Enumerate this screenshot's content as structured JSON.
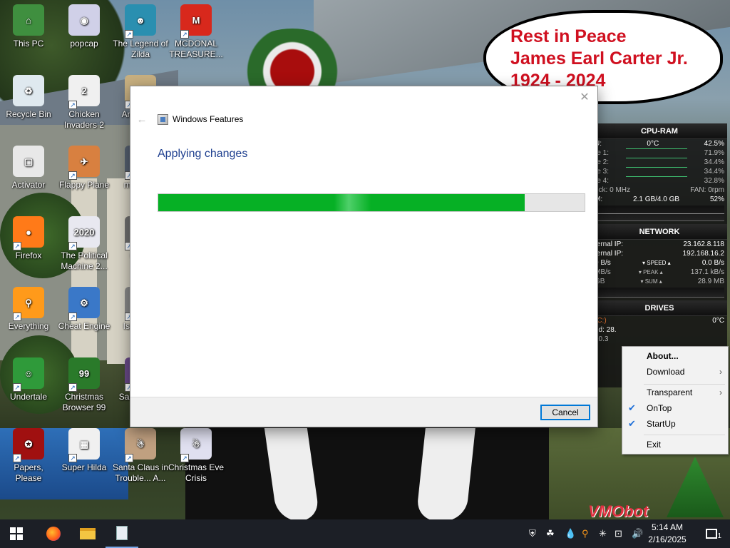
{
  "desktop_icons": [
    {
      "label": "This PC",
      "glyph": "⌂",
      "color": "#3f8f3f",
      "shortcut": false
    },
    {
      "label": "popcap",
      "glyph": "◉",
      "color": "#d0d0e8",
      "shortcut": false
    },
    {
      "label": "The Legend of Zilda",
      "glyph": "☻",
      "color": "#2a8fb0",
      "shortcut": true
    },
    {
      "label": "MCDONAL TREASURE...",
      "glyph": "M",
      "color": "#d8281c",
      "shortcut": true
    },
    {
      "label": "Recycle Bin",
      "glyph": "♻",
      "color": "#dfe9ef",
      "shortcut": false
    },
    {
      "label": "Chicken Invaders 2",
      "glyph": "2",
      "color": "#f0f0f0",
      "shortcut": true
    },
    {
      "label": "An... Se...",
      "glyph": "☺",
      "color": "#c8b080",
      "shortcut": true
    },
    {
      "label": "Activator",
      "glyph": "▢",
      "color": "#e8e8e8",
      "shortcut": false
    },
    {
      "label": "Flappy Plane",
      "glyph": "✈",
      "color": "#d88040",
      "shortcut": true
    },
    {
      "label": "mo... 9...",
      "glyph": "▣",
      "color": "#556070",
      "shortcut": true
    },
    {
      "label": "Firefox",
      "glyph": "●",
      "color": "#ff7a18",
      "shortcut": true
    },
    {
      "label": "The Political Machine 2...",
      "glyph": "2020",
      "color": "#e8e8f0",
      "shortcut": true
    },
    {
      "label": "uns...",
      "glyph": "▤",
      "color": "#707070",
      "shortcut": true
    },
    {
      "label": "Everything",
      "glyph": "⚲",
      "color": "#ff9a1a",
      "shortcut": true
    },
    {
      "label": "Cheat Engine",
      "glyph": "⚙",
      "color": "#3a78c8",
      "shortcut": true
    },
    {
      "label": "Islan... ...",
      "glyph": "▦",
      "color": "#8a8a8a",
      "shortcut": true
    },
    {
      "label": "Undertale",
      "glyph": "☺",
      "color": "#2f9a3a",
      "shortcut": true
    },
    {
      "label": "Christmas Browser 99",
      "glyph": "99",
      "color": "#2a7a2a",
      "shortcut": true
    },
    {
      "label": "Santa... T...",
      "glyph": "▥",
      "color": "#6a4a8a",
      "shortcut": true
    },
    {
      "label": "Papers, Please",
      "glyph": "✪",
      "color": "#a01010",
      "shortcut": true
    },
    {
      "label": "Super Hilda",
      "glyph": "▦",
      "color": "#f0f0f0",
      "shortcut": true
    },
    {
      "label": "Santa Claus in Trouble... A...",
      "glyph": "☃",
      "color": "#c0a080",
      "shortcut": true
    },
    {
      "label": "Christmas Eve Crisis",
      "glyph": "☃",
      "color": "#e0e0f0",
      "shortcut": true
    }
  ],
  "cloud": {
    "line1": "Rest in Peace",
    "line2": "James Earl Carter Jr.",
    "line3": "1924 - 2024"
  },
  "gadget": {
    "cpu_title": "CPU-RAM",
    "cpu_label": "U:",
    "cpu_temp": "0°C",
    "cpu_total": "42.5%",
    "cores": [
      {
        "label": "re 1:",
        "value": "71.9%"
      },
      {
        "label": "re 2:",
        "value": "34.4%"
      },
      {
        "label": "re 3:",
        "value": "34.4%"
      },
      {
        "label": "re 4:",
        "value": "32.8%"
      }
    ],
    "clock_label": "ock: 0 MHz",
    "fan_label": "FAN: 0rpm",
    "ram_label": "M:",
    "ram_used": "2.1 GB/4.0 GB",
    "ram_percent": "52%",
    "net_title": "NETWORK",
    "ext_ip_label": "ternal IP:",
    "ext_ip": "23.162.8.118",
    "int_ip_label": "ternal IP:",
    "int_ip": "192.168.16.2",
    "speed_left": "0 B/s",
    "speed_label": "▾ SPEED ▴",
    "speed_right": "0.0 B/s",
    "peak_left": "MB/s",
    "peak_label": "▾ PEAK ▴",
    "peak_right": "137.1 kB/s",
    "sum_left": "GB",
    "sum_label": "▾ SUM ▴",
    "sum_right": "28.9 MB",
    "drives_title": "DRIVES",
    "drive_c": "(C:)",
    "drive_temp": "0°C",
    "drive_read": "ed: 28.",
    "drive_val": "10.3"
  },
  "dialog": {
    "title": "Windows Features",
    "heading": "Applying changes",
    "progress_fraction": 0.86,
    "cancel_label": "Cancel",
    "close_glyph": "✕",
    "back_glyph": "←"
  },
  "context_menu": [
    {
      "label": "About...",
      "bold": true,
      "checked": false,
      "submenu": false
    },
    {
      "label": "Download",
      "bold": false,
      "checked": false,
      "submenu": true
    },
    {
      "label": "Transparent",
      "bold": false,
      "checked": false,
      "submenu": true
    },
    {
      "label": "OnTop",
      "bold": false,
      "checked": true,
      "submenu": false
    },
    {
      "label": "StartUp",
      "bold": false,
      "checked": true,
      "submenu": false
    },
    {
      "label": "Exit",
      "bold": false,
      "checked": false,
      "submenu": false
    }
  ],
  "watermark": "VMObot",
  "taskbar": {
    "time": "5:14 AM",
    "date": "2/16/2025",
    "notification_count": "1",
    "pinned": [
      "firefox-icon",
      "file-explorer-icon",
      "notepad-icon"
    ]
  },
  "colors": {
    "accent": "#0078d7",
    "progress_green": "#06b025",
    "heading_blue": "#1e3f8f",
    "cloud_red": "#d01020",
    "taskbar_bg": "#1c1f26"
  }
}
